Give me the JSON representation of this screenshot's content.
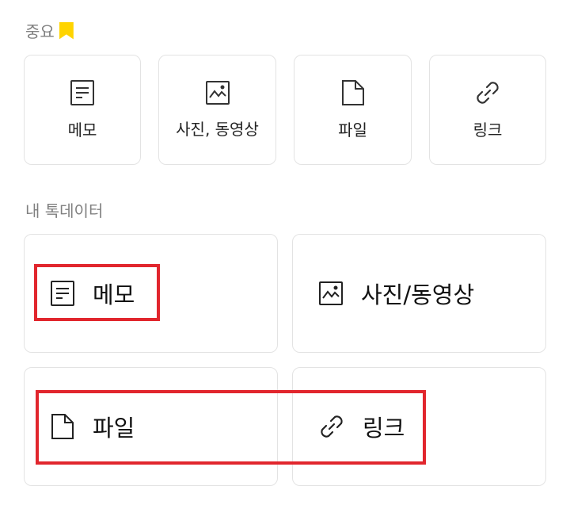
{
  "important": {
    "title": "중요",
    "accent_color": "#ffd400",
    "items": [
      {
        "label": "메모",
        "icon": "memo-icon"
      },
      {
        "label": "사진, 동영상",
        "icon": "image-icon"
      },
      {
        "label": "파일",
        "icon": "file-icon"
      },
      {
        "label": "링크",
        "icon": "link-icon"
      }
    ]
  },
  "my_talk_data": {
    "title": "내 톡데이터",
    "items": [
      {
        "label": "메모",
        "icon": "memo-icon"
      },
      {
        "label": "사진/동영상",
        "icon": "image-icon"
      },
      {
        "label": "파일",
        "icon": "file-icon"
      },
      {
        "label": "링크",
        "icon": "link-icon"
      }
    ]
  },
  "highlight_color": "#e1262d"
}
